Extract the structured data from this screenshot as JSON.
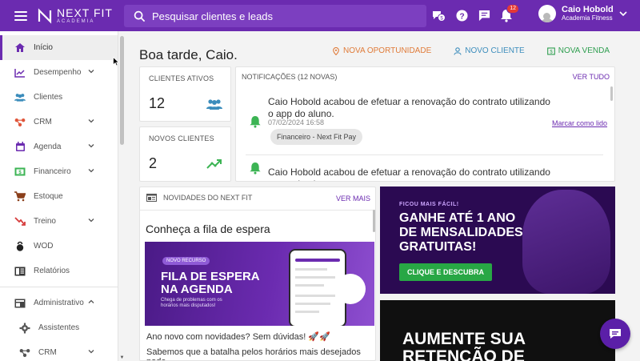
{
  "topbar": {
    "logo_line1": "NEXT FIT",
    "logo_line2": "ACADEMIA",
    "search_placeholder": "Pesquisar clientes e leads",
    "notifications_count": "12",
    "user_name": "Caio Hobold",
    "user_company": "Academia Fitness",
    "icons": [
      "chat-money-icon",
      "help-icon",
      "message-icon",
      "bell-icon",
      "chevron-down-icon"
    ]
  },
  "sidebar": {
    "items": [
      {
        "label": "Início",
        "icon": "home-icon"
      },
      {
        "label": "Desempenho",
        "icon": "chart-icon"
      },
      {
        "label": "Clientes",
        "icon": "people-icon"
      },
      {
        "label": "CRM",
        "icon": "crm-icon"
      },
      {
        "label": "Agenda",
        "icon": "calendar-icon"
      },
      {
        "label": "Financeiro",
        "icon": "money-icon"
      },
      {
        "label": "Estoque",
        "icon": "cart-icon"
      },
      {
        "label": "Treino",
        "icon": "trend-icon"
      },
      {
        "label": "WOD",
        "icon": "kettlebell-icon"
      },
      {
        "label": "Relatórios",
        "icon": "report-icon"
      },
      {
        "label": "Administrativo",
        "icon": "admin-icon"
      },
      {
        "label": "Assistentes",
        "icon": "gear-icon"
      },
      {
        "label": "CRM",
        "icon": "crm-icon"
      }
    ]
  },
  "main": {
    "greeting": "Boa tarde, Caio.",
    "actions": [
      {
        "label": "NOVA OPORTUNIDADE",
        "color": "#e07b39"
      },
      {
        "label": "NOVO CLIENTE",
        "color": "#3c8dbc"
      },
      {
        "label": "NOVA VENDA",
        "color": "#2e9e4f"
      }
    ],
    "stats": [
      {
        "label": "CLIENTES ATIVOS",
        "value": "12"
      },
      {
        "label": "NOVOS CLIENTES",
        "value": "2"
      }
    ],
    "notifications": {
      "title": "NOTIFICAÇÕES (12 NOVAS)",
      "link": "VER TUDO",
      "items": [
        {
          "text": "Caio Hobold acabou de efetuar a renovação do contrato utilizando o app do aluno.",
          "date": "07/02/2024 16:58",
          "chip": "Financeiro - Next Fit Pay",
          "action": "Marcar como lido"
        },
        {
          "text": "Caio Hobold acabou de efetuar a renovação do contrato utilizando o app do aluno."
        }
      ]
    },
    "news": {
      "header": "NOVIDADES DO NEXT FIT",
      "link": "VER MAIS",
      "title": "Conheça a fila de espera",
      "image_tag": "NOVO RECURSO",
      "image_heading": "FILA DE ESPERA NA AGENDA",
      "image_sub": "Chega de problemas com os horários mais disputados!",
      "text1": "Ano novo com novidades? Sem dúvidas! 🚀🚀",
      "text2": "Sabemos que a batalha pelos horários mais desejados pode"
    },
    "promo": {
      "kicker": "FICOU MAIS FÁCIL!",
      "title": "GANHE ATÉ 1 ANO DE MENSALIDADES GRATUITAS!",
      "button": "CLIQUE E DESCUBRA"
    },
    "promo2": {
      "title": "AUMENTE SUA RETENÇÃO DE"
    }
  },
  "colors": {
    "brand": "#6b2bb0",
    "green": "#3cb454",
    "blue_stat": "#3c8dbc"
  }
}
